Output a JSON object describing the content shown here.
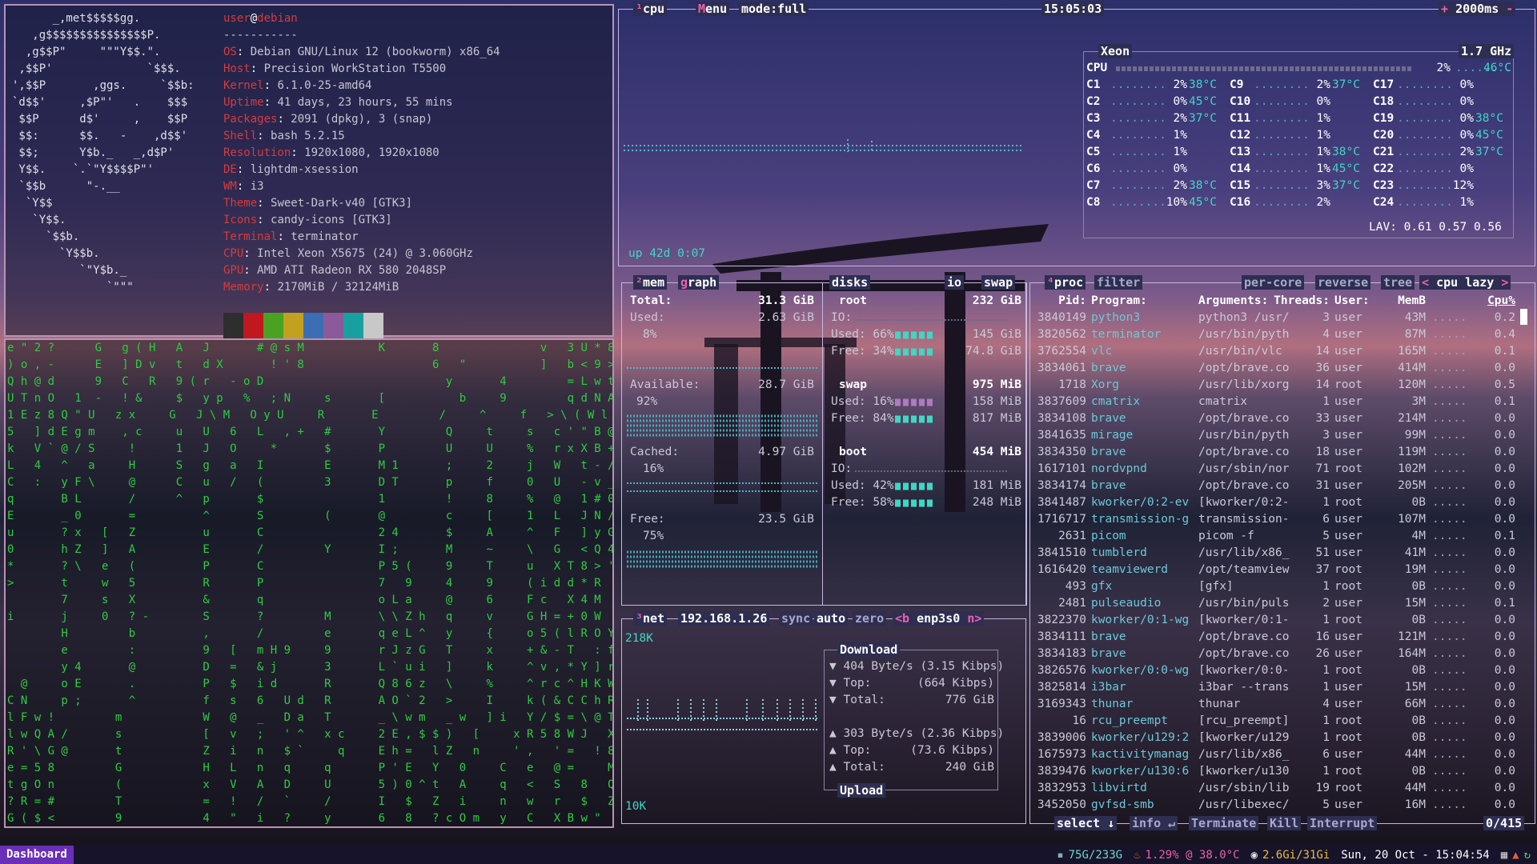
{
  "neofetch": {
    "logo": [
      "      _,met$$$$$gg.",
      "   ,g$$$$$$$$$$$$$$$P.",
      "  ,g$$P\"     \"\"\"Y$$.\".",
      " ,$$P'              `$$$.",
      "',$$P       ,ggs.     `$$b:",
      "`d$$'     ,$P\"'   .    $$$",
      " $$P      d$'     ,    $$P",
      " $$:      $$.   -    ,d$$'",
      " $$;      Y$b._   _,d$P'",
      " Y$$.    `.`\"Y$$$$P\"'",
      " `$$b      \"-.__",
      "  `Y$$",
      "   `Y$$.",
      "     `$$b.",
      "       `Y$$b.",
      "          `\"Y$b._",
      "              `\"\"\""
    ],
    "user": "user",
    "at": "@",
    "host": "debian",
    "sep": "-----------",
    "info": [
      {
        "k": "OS",
        "v": "Debian GNU/Linux 12 (bookworm) x86_64"
      },
      {
        "k": "Host",
        "v": "Precision WorkStation T5500"
      },
      {
        "k": "Kernel",
        "v": "6.1.0-25-amd64"
      },
      {
        "k": "Uptime",
        "v": "41 days, 23 hours, 55 mins"
      },
      {
        "k": "Packages",
        "v": "2091 (dpkg), 3 (snap)"
      },
      {
        "k": "Shell",
        "v": "bash 5.2.15"
      },
      {
        "k": "Resolution",
        "v": "1920x1080, 1920x1080"
      },
      {
        "k": "DE",
        "v": "lightdm-xsession"
      },
      {
        "k": "WM",
        "v": "i3"
      },
      {
        "k": "Theme",
        "v": "Sweet-Dark-v40 [GTK3]"
      },
      {
        "k": "Icons",
        "v": "candy-icons [GTK3]"
      },
      {
        "k": "Terminal",
        "v": "terminator"
      },
      {
        "k": "CPU",
        "v": "Intel Xeon X5675 (24) @ 3.060GHz"
      },
      {
        "k": "GPU",
        "v": "AMD ATI Radeon RX 580 2048SP"
      },
      {
        "k": "Memory",
        "v": "2170MiB / 32124MiB"
      }
    ],
    "colors": [
      "#2e2e2e",
      "#c0181e",
      "#4aa320",
      "#c4a020",
      "#3c6eb4",
      "#8c5a9a",
      "#18a0a0",
      "#c8c8c8"
    ]
  },
  "matrix": [
    "e \" 2 ?      G   g ( H   A   J       # @ s M           K       8               v   3 U * 8",
    ") o , -      E   ] D v   t   d X       ! ' 8                   6   \"           ]   b < 9 >",
    "Q h @ d      9   C   R   9 ( r   - o D                           y       4         = L w t",
    "U T n O   1  -   ! &     $   y p   %   ; N     s       [           b     9         q d N A [",
    "1 E z 8 Q \" U   z x     G   J \\ M   O y U     R       E         /     ^     f   > \\ ( W l",
    "5   ] d E g m    , c     u   U   6   L   , +   #       Y         Q     t     s   c ' \" B @",
    "k   V ` @ / S     !      1   J   O     *       $       P         U     U     %   r x X B +",
    "L   4   ^   a     H      S   g   a   I         E       M 1       ;     2     j   W   t - /",
    "C   :   y F \\     @      C   u   /   (         3       D T       p     f     0   U   - v _",
    "q       B L       /      ^   p       $                 1         !     8     %   @   1 # 0",
    "E       _ 0       =          ^       S         (       @         c     [     1   L   J N /",
    "u       ? x   [   Z          u       C                 2 4       $     A     ^   F   ] y G",
    "0       h Z   ]   A          E       /         Y       I ;       M     ~     \\   G   < Q 4",
    "*       ? \\   e   (          P       C                 P 5 (     9     T     u   X T 8 > '",
    ">       t     w   5          R       P                 7   9     4     9     ( i d d * R   )",
    "        7     s   X          &       q                 o L a     @     6     F c   X 4 M",
    "i       j     0   ? -        S       ?         M       \\ \\ Z h   q     v     G H = + 0 W",
    "        H         b          ,       /         e       q e L ^   y     {     o 5 ( l R O Y",
    "        e         :          9   [   m H 9     9       r J z G   T     x     + & - T   : f",
    "        y 4       @          D   =   & j       3       L ` u i   ]     k     ^ v , * Y ] r",
    "  @     o E       .          P   $   i d       R       Q 8 6 z   \\     %     ^ r c ^ H K W",
    "C N     p ;       ^          f   s   6   U d   R       A O ` 2   >     I     k ( & C C h R",
    "l F w !         m            W   @   _   D a   T       _ \\ w m   _ w   ] i   Y / $ = \\ @ T",
    "l w Q A /       s            [   v   ;   ' ^   x c     2 E , $ $ )   [     x R 5 8 W J   X",
    "R ' \\ G @       t            Z   i   n   $ `     q     E h =   l Z   n     ' ,   ' =   ! 8",
    "e = 5 8         G            H   L   n   q     q       P ' E   Y   0     C   e   @ =     M",
    "t g O n         (            x   V   A   D     U       5 ) 0 ^ t   A     q   <   S   8   Q",
    "? R = #         T            =   !   /   `     /       I   $   Z   i     n   w   r   $   Z",
    "G ( $ <         9            4   \"   i   ?     y       6   8   ? c O m   y   C   X B w \"   z"
  ],
  "cpu": {
    "tab_num": "¹",
    "tab": "cpu",
    "menu": "Menu",
    "mode": "mode:full",
    "clock": "15:05:03",
    "interval": "2000ms",
    "plus": "+",
    "minus": "-",
    "uptime": "up 42d 0:07",
    "model": "Xeon",
    "freq": "1.7 GHz",
    "total_label": "CPU",
    "total_pct": "2%",
    "total_temp": "46°C",
    "cores": [
      {
        "n": "C1",
        "p": "2%",
        "t": "38°C"
      },
      {
        "n": "C2",
        "p": "0%",
        "t": "45°C"
      },
      {
        "n": "C3",
        "p": "2%",
        "t": "37°C"
      },
      {
        "n": "C4",
        "p": "1%",
        "t": ""
      },
      {
        "n": "C5",
        "p": "1%",
        "t": ""
      },
      {
        "n": "C6",
        "p": "0%",
        "t": ""
      },
      {
        "n": "C7",
        "p": "2%",
        "t": "38°C"
      },
      {
        "n": "C8",
        "p": "10%",
        "t": "45°C"
      },
      {
        "n": "C9",
        "p": "2%",
        "t": "37°C"
      },
      {
        "n": "C10",
        "p": "0%",
        "t": ""
      },
      {
        "n": "C11",
        "p": "1%",
        "t": ""
      },
      {
        "n": "C12",
        "p": "1%",
        "t": ""
      },
      {
        "n": "C13",
        "p": "1%",
        "t": "38°C"
      },
      {
        "n": "C14",
        "p": "1%",
        "t": "45°C"
      },
      {
        "n": "C15",
        "p": "3%",
        "t": "37°C"
      },
      {
        "n": "C16",
        "p": "2%",
        "t": ""
      },
      {
        "n": "C17",
        "p": "0%",
        "t": ""
      },
      {
        "n": "C18",
        "p": "0%",
        "t": ""
      },
      {
        "n": "C19",
        "p": "0%",
        "t": "38°C"
      },
      {
        "n": "C20",
        "p": "0%",
        "t": "45°C"
      },
      {
        "n": "C21",
        "p": "2%",
        "t": "37°C"
      },
      {
        "n": "C22",
        "p": "0%",
        "t": ""
      },
      {
        "n": "C23",
        "p": "12%",
        "t": ""
      },
      {
        "n": "C24",
        "p": "1%",
        "t": ""
      }
    ],
    "lav": "LAV: 0.61 0.57 0.56"
  },
  "mem": {
    "tab_num": "²",
    "tab": "mem",
    "graph": "graph",
    "total_label": "Total:",
    "total": "31.3 GiB",
    "used_label": "Used:",
    "used": "2.63 GiB",
    "used_pct": "8%",
    "avail_label": "Available:",
    "avail": "28.7 GiB",
    "avail_pct": "92%",
    "cached_label": "Cached:",
    "cached": "4.97 GiB",
    "cached_pct": "16%",
    "free_label": "Free:",
    "free": "23.5 GiB",
    "free_pct": "75%"
  },
  "disks": {
    "tab": "disks",
    "io": "io",
    "swap_tab": "swap",
    "root": {
      "name": "root",
      "size": "232 GiB",
      "io": "IO:",
      "used": "Used: 66%",
      "used_v": "145 GiB",
      "free": "Free: 34%",
      "free_v": "74.8 GiB"
    },
    "swap": {
      "name": "swap",
      "size": "975 MiB",
      "used": "Used: 16%",
      "used_v": "158 MiB",
      "free": "Free: 84%",
      "free_v": "817 MiB"
    },
    "boot": {
      "name": "boot",
      "size": "454 MiB",
      "io": "IO:",
      "used": "Used: 42%",
      "used_v": "181 MiB",
      "free": "Free: 58%",
      "free_v": "248 MiB"
    }
  },
  "net": {
    "tab_num": "³",
    "tab": "net",
    "ip": "192.168.1.26",
    "sync": "sync",
    "auto": "auto",
    "zero": "zero",
    "iface_prev": "<b",
    "iface": "enp3s0",
    "iface_next": "n>",
    "top_scale": "218K",
    "bottom_scale": "10K",
    "download": "Download",
    "dl_rate": "▼ 404 Byte/s (3.15 Kibps)",
    "dl_top": "▼ Top:",
    "dl_top_v": "(664 Kibps)",
    "dl_total": "▼ Total:",
    "dl_total_v": "776 GiB",
    "ul_rate": "▲ 303 Byte/s (2.36 Kibps)",
    "ul_top": "▲ Top:",
    "ul_top_v": "(73.6 Kibps)",
    "ul_total": "▲ Total:",
    "ul_total_v": "240 GiB",
    "upload": "Upload"
  },
  "proc": {
    "tab_num": "⁴",
    "tab": "proc",
    "filter": "filter",
    "percore": "per-core",
    "reverse": "reverse",
    "tree": "tree",
    "sort_prev": "<",
    "sort": "cpu lazy",
    "sort_next": ">",
    "headers": [
      "Pid:",
      "Program:",
      "Arguments:",
      "Threads:",
      "User:",
      "MemB",
      "Cpu%"
    ],
    "rows": [
      [
        "3840149",
        "python3",
        "python3 /usr/",
        "3",
        "user",
        "43M",
        "0.2"
      ],
      [
        "3820562",
        "terminator",
        "/usr/bin/pyth",
        "4",
        "user",
        "87M",
        "0.4"
      ],
      [
        "3762554",
        "vlc",
        "/usr/bin/vlc",
        "14",
        "user",
        "165M",
        "0.1"
      ],
      [
        "3834061",
        "brave",
        "/opt/brave.co",
        "36",
        "user",
        "414M",
        "0.0"
      ],
      [
        "1718",
        "Xorg",
        "/usr/lib/xorg",
        "14",
        "root",
        "120M",
        "0.5"
      ],
      [
        "3837609",
        "cmatrix",
        "cmatrix",
        "1",
        "user",
        "3M",
        "0.1"
      ],
      [
        "3834108",
        "brave",
        "/opt/brave.co",
        "33",
        "user",
        "214M",
        "0.0"
      ],
      [
        "3841635",
        "mirage",
        "/usr/bin/pyth",
        "3",
        "user",
        "99M",
        "0.0"
      ],
      [
        "3834350",
        "brave",
        "/opt/brave.co",
        "18",
        "user",
        "119M",
        "0.0"
      ],
      [
        "1617101",
        "nordvpnd",
        "/usr/sbin/nor",
        "71",
        "root",
        "102M",
        "0.0"
      ],
      [
        "3834174",
        "brave",
        "/opt/brave.co",
        "31",
        "user",
        "205M",
        "0.0"
      ],
      [
        "3841487",
        "kworker/0:2-ev",
        "[kworker/0:2-",
        "1",
        "root",
        "0B",
        "0.0"
      ],
      [
        "1716717",
        "transmission-g",
        "transmission-",
        "6",
        "user",
        "107M",
        "0.0"
      ],
      [
        "2631",
        "picom",
        "picom -f",
        "5",
        "user",
        "4M",
        "0.1"
      ],
      [
        "3841510",
        "tumblerd",
        "/usr/lib/x86_",
        "51",
        "user",
        "41M",
        "0.0"
      ],
      [
        "1616420",
        "teamviewerd",
        "/opt/teamview",
        "37",
        "root",
        "19M",
        "0.0"
      ],
      [
        "493",
        "gfx",
        "[gfx]",
        "1",
        "root",
        "0B",
        "0.0"
      ],
      [
        "2481",
        "pulseaudio",
        "/usr/bin/puls",
        "2",
        "user",
        "15M",
        "0.1"
      ],
      [
        "3822370",
        "kworker/0:1-wg",
        "[kworker/0:1-",
        "1",
        "root",
        "0B",
        "0.0"
      ],
      [
        "3834111",
        "brave",
        "/opt/brave.co",
        "16",
        "user",
        "121M",
        "0.0"
      ],
      [
        "3834183",
        "brave",
        "/opt/brave.co",
        "26",
        "user",
        "164M",
        "0.0"
      ],
      [
        "3826576",
        "kworker/0:0-wg",
        "[kworker/0:0-",
        "1",
        "root",
        "0B",
        "0.0"
      ],
      [
        "3825814",
        "i3bar",
        "i3bar --trans",
        "1",
        "user",
        "15M",
        "0.0"
      ],
      [
        "3169343",
        "thunar",
        "thunar",
        "4",
        "user",
        "66M",
        "0.0"
      ],
      [
        "16",
        "rcu_preempt",
        "[rcu_preempt]",
        "1",
        "root",
        "0B",
        "0.0"
      ],
      [
        "3839006",
        "kworker/u129:2",
        "[kworker/u129",
        "1",
        "root",
        "0B",
        "0.0"
      ],
      [
        "1675973",
        "kactivitymanag",
        "/usr/lib/x86_",
        "6",
        "user",
        "44M",
        "0.0"
      ],
      [
        "3839476",
        "kworker/u130:6",
        "[kworker/u130",
        "1",
        "root",
        "0B",
        "0.0"
      ],
      [
        "3832953",
        "libvirtd",
        "/usr/sbin/lib",
        "19",
        "root",
        "44M",
        "0.0"
      ],
      [
        "3452050",
        "gvfsd-smb",
        "/usr/libexec/",
        "5",
        "user",
        "16M",
        "0.0"
      ]
    ],
    "select": "select",
    "info": "info",
    "terminate": "Terminate",
    "kill": "Kill",
    "interrupt": "Interrupt",
    "count": "0/415"
  },
  "taskbar": {
    "dashboard": "Dashboard",
    "disk": "75G/233G",
    "cpu": "1.29% @ 38.0°C",
    "mem": "2.6Gi/31Gi",
    "datetime": "Sun, 20 Oct - 15:04:54"
  }
}
